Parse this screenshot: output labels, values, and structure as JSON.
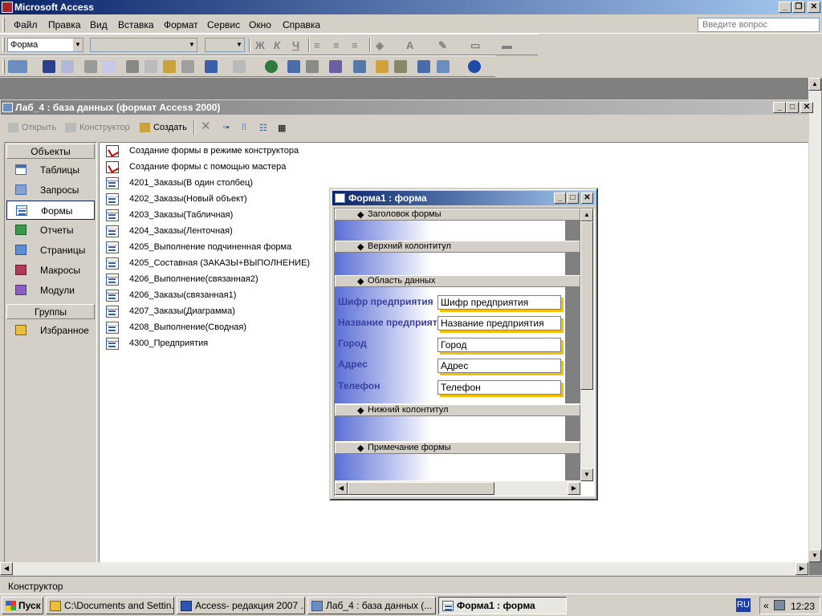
{
  "app": {
    "title": "Microsoft Access"
  },
  "menu": {
    "items": [
      "Файл",
      "Правка",
      "Вид",
      "Вставка",
      "Формат",
      "Сервис",
      "Окно",
      "Справка"
    ],
    "ask_placeholder": "Введите вопрос"
  },
  "format_toolbar": {
    "object_combo": "Форма"
  },
  "db_window": {
    "title": "Лаб_4 : база данных (формат Access 2000)",
    "toolbar": {
      "open": "Открыть",
      "design": "Конструктор",
      "create": "Создать"
    },
    "groups": {
      "objects_label": "Объекты",
      "objects": [
        "Таблицы",
        "Запросы",
        "Формы",
        "Отчеты",
        "Страницы",
        "Макросы",
        "Модули"
      ],
      "selected": "Формы",
      "groups_label": "Группы",
      "favorites": "Избранное"
    },
    "items": [
      "Создание формы в режиме конструктора",
      "Создание формы с помощью мастера",
      "4201_Заказы(В один столбец)",
      "4202_Заказы(Новый объект)",
      "4203_Заказы(Табличная)",
      "4204_Заказы(Ленточная)",
      "4205_Выполнение подчиненная форма",
      "4205_Составная (ЗАКАЗЫ+ВЫПОЛНЕНИЕ)",
      "4206_Выполнение(связанная2)",
      "4206_Заказы(связанная1)",
      "4207_Заказы(Диаграмма)",
      "4208_Выполнение(Сводная)",
      "4300_Предприятия"
    ]
  },
  "form_window": {
    "title": "Форма1 : форма",
    "sections": {
      "form_header": "Заголовок формы",
      "page_header": "Верхний колонтитул",
      "detail": "Область данных",
      "page_footer": "Нижний колонтитул",
      "form_footer": "Примечание формы"
    },
    "fields": [
      {
        "label": "Шифр предприятия",
        "control": "Шифр предприятия"
      },
      {
        "label": "Название предприят",
        "control": "Название предприятия"
      },
      {
        "label": "Город",
        "control": "Город"
      },
      {
        "label": "Адрес",
        "control": "Адрес"
      },
      {
        "label": "Телефон",
        "control": "Телефон"
      }
    ]
  },
  "status": {
    "text": "Конструктор"
  },
  "taskbar": {
    "start": "Пуск",
    "tasks": [
      "C:\\Documents and Settin...",
      "Access- редакция 2007 ...",
      "Лаб_4 : база данных (...",
      "Форма1 : форма"
    ],
    "lang": "RU",
    "clock": "12:23"
  },
  "colors": {
    "title_active": "#0a246a",
    "title_gradient_end": "#a6caf0",
    "face": "#d4d0c8",
    "label_text": "#3b3fa0",
    "control_shadow": "#f5c000"
  }
}
